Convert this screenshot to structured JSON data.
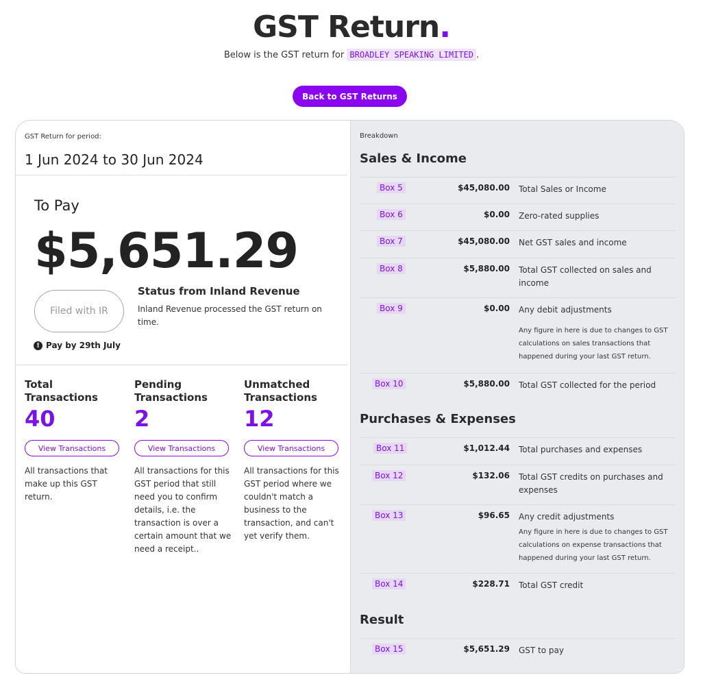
{
  "page": {
    "title": "GST Return",
    "title_dot": ".",
    "subtitle_prefix": "Below is the GST return for",
    "company": "BROADLEY SPEAKING LIMITED",
    "subtitle_suffix": ".",
    "back_button": "Back to GST Returns"
  },
  "summary": {
    "period_label": "GST Return for period:",
    "period": "1 Jun 2024 to 30 Jun 2024",
    "to_pay_label": "To Pay",
    "to_pay_amount": "$5,651.29",
    "filed_button": "Filed with IR",
    "status_title": "Status from Inland Revenue",
    "status_text": "Inland Revenue processed the GST return on time.",
    "pay_by": "Pay by 29th July",
    "pay_by_icon": "exclamation-circle-icon"
  },
  "stats": [
    {
      "title": "Total Transactions",
      "count": "40",
      "button": "View Transactions",
      "description": "All transactions that make up this GST return."
    },
    {
      "title": "Pending Transactions",
      "count": "2",
      "button": "View Transactions",
      "description": "All transactions for this GST period that still need you to confirm details, i.e. the transaction is over a certain amount that we need a receipt.."
    },
    {
      "title": "Unmatched Transactions",
      "count": "12",
      "button": "View Transactions",
      "description": "All transactions for this GST period where we couldn't match a business to the transaction, and can't yet verify them."
    }
  ],
  "breakdown": {
    "label": "Breakdown",
    "sections": [
      {
        "title": "Sales & Income"
      },
      {
        "title": "Purchases & Expenses"
      },
      {
        "title": "Result"
      }
    ],
    "rows": [
      {
        "box": "Box 5",
        "amount": "$45,080.00",
        "description": "Total Sales or Income",
        "note": ""
      },
      {
        "box": "Box 6",
        "amount": "$0.00",
        "description": "Zero-rated supplies",
        "note": ""
      },
      {
        "box": "Box 7",
        "amount": "$45,080.00",
        "description": "Net GST sales and income",
        "note": ""
      },
      {
        "box": "Box 8",
        "amount": "$5,880.00",
        "description": "Total GST collected on sales and income",
        "note": ""
      },
      {
        "box": "Box 9",
        "amount": "$0.00",
        "description": "Any debit adjustments",
        "note": "Any figure in here is due to changes to GST calculations on sales transactions that happened during your last GST return."
      },
      {
        "box": "Box 10",
        "amount": "$5,880.00",
        "description": "Total GST collected for the period",
        "note": ""
      },
      {
        "box": "Box 11",
        "amount": "$1,012.44",
        "description": "Total purchases and expenses",
        "note": ""
      },
      {
        "box": "Box 12",
        "amount": "$132.06",
        "description": "Total GST credits on purchases and expenses",
        "note": ""
      },
      {
        "box": "Box 13",
        "amount": "$96.65",
        "description": "Any credit adjustments",
        "note": "Any figure in here is due to changes to GST calculations on expense transactions that happened during your last GST return."
      },
      {
        "box": "Box 14",
        "amount": "$228.71",
        "description": "Total GST credit",
        "note": ""
      },
      {
        "box": "Box 15",
        "amount": "$5,651.29",
        "description": "GST to pay",
        "note": ""
      }
    ]
  },
  "colors": {
    "accent": "#8a06ef",
    "accent_text": "#7b12e6",
    "panel": "#eaebef"
  }
}
